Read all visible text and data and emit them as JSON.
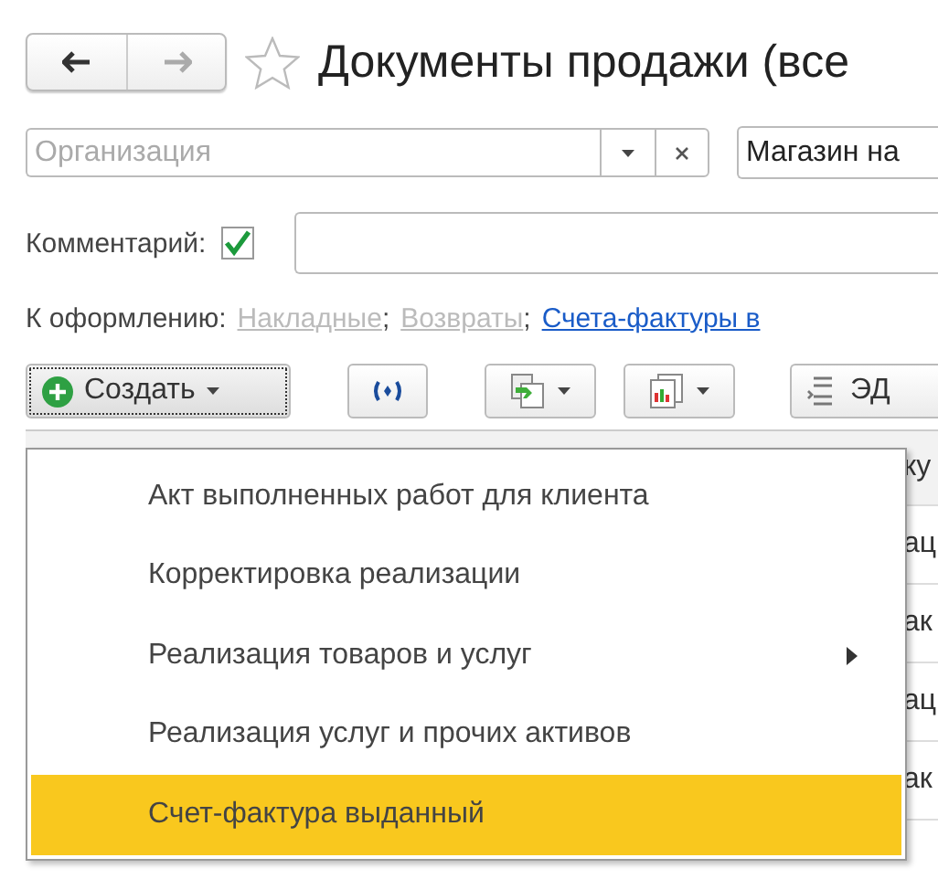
{
  "header": {
    "title": "Документы продажи (все"
  },
  "filters": {
    "organization": {
      "placeholder": "Организация"
    },
    "store": {
      "value": "Магазин на"
    }
  },
  "comment": {
    "label": "Комментарий:",
    "checked": true
  },
  "to_process": {
    "label": "К оформлению:",
    "links": [
      {
        "text": "Накладные",
        "disabled": true,
        "after": ";"
      },
      {
        "text": "Возвраты",
        "disabled": true,
        "after": ";"
      },
      {
        "text": "Счета-фактуры в",
        "disabled": false
      }
    ]
  },
  "toolbar": {
    "create_label": "Создать",
    "edo_label": "ЭД"
  },
  "table": {
    "header": "ку",
    "rows": [
      "ац",
      "ак",
      "ац",
      "ак"
    ]
  },
  "menu": {
    "items": [
      {
        "text": "Акт выполненных работ для клиента",
        "submenu": false,
        "selected": false
      },
      {
        "text": "Корректировка реализации",
        "submenu": false,
        "selected": false
      },
      {
        "text": "Реализация товаров и услуг",
        "submenu": true,
        "selected": false
      },
      {
        "text": "Реализация услуг и прочих активов",
        "submenu": false,
        "selected": false
      },
      {
        "text": "Счет-фактура выданный",
        "submenu": false,
        "selected": true
      }
    ]
  }
}
